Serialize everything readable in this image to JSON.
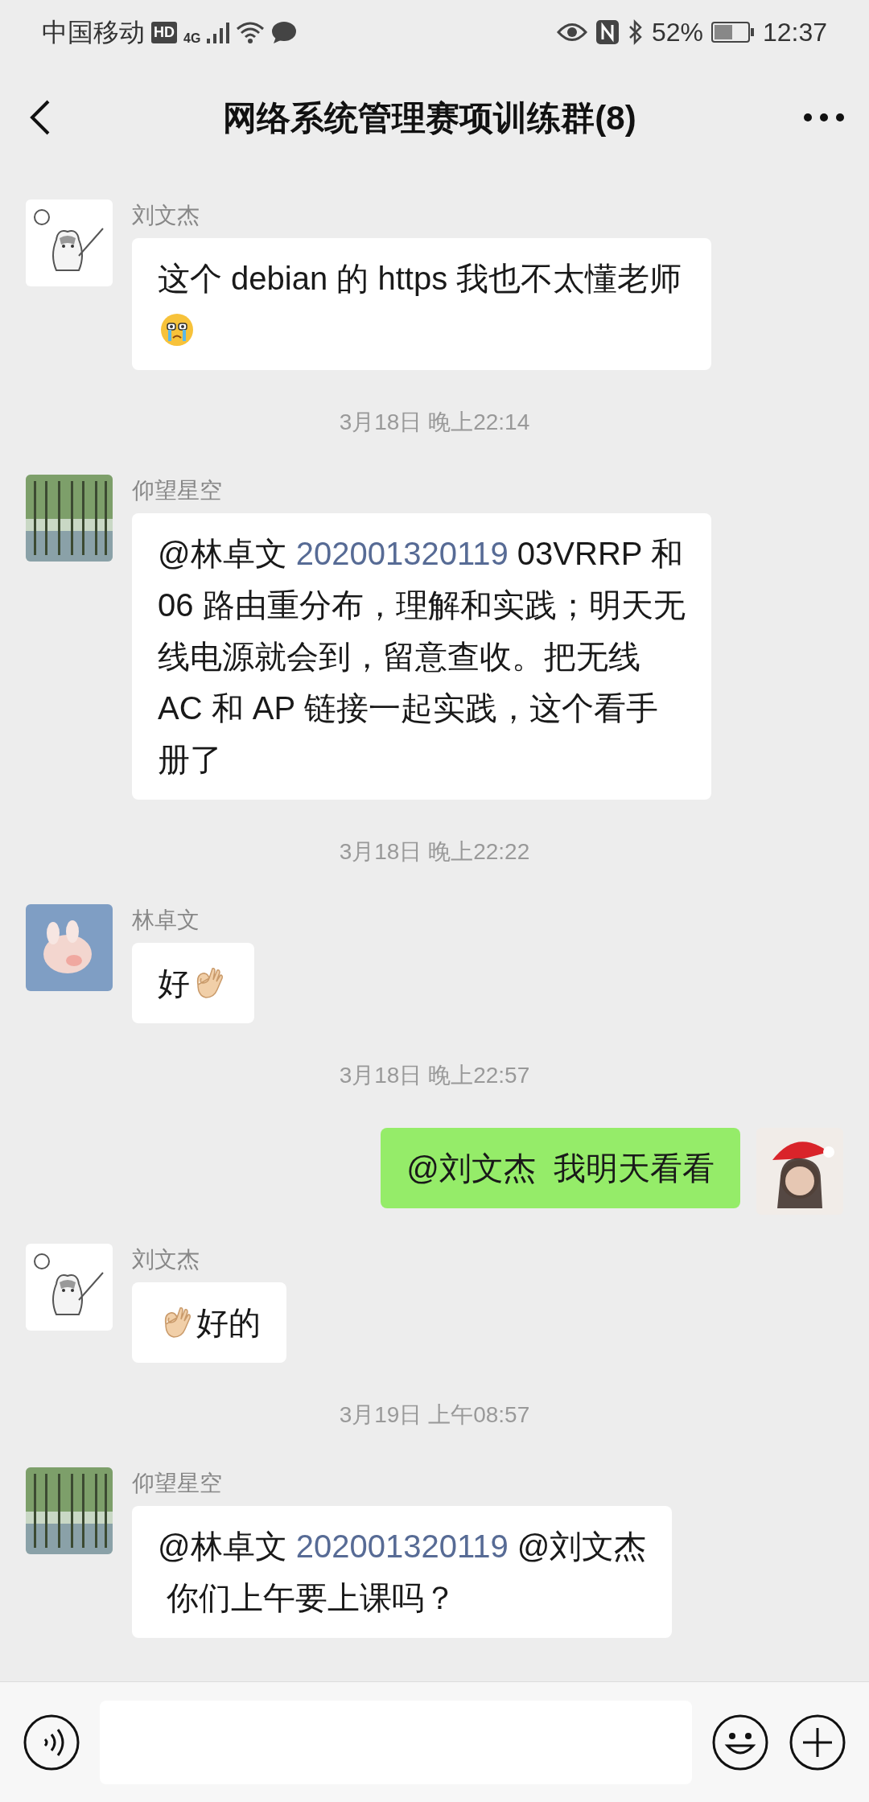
{
  "status_bar": {
    "carrier": "中国移动",
    "hd": "HD",
    "network": "4G",
    "battery": "52%",
    "time": "12:37"
  },
  "header": {
    "title": "网络系统管理赛项训练群(8)"
  },
  "messages": [
    {
      "kind": "incoming",
      "avatar": {
        "kind": "cat"
      },
      "sender": "刘文杰",
      "parts": [
        {
          "kind": "text",
          "text": "这个 debian 的 https 我也不太懂老师"
        },
        {
          "kind": "cry"
        }
      ]
    },
    {
      "kind": "time",
      "text": "3月18日 晚上22:14"
    },
    {
      "kind": "incoming",
      "avatar": {
        "kind": "trees"
      },
      "sender": "仰望星空",
      "parts": [
        {
          "kind": "text",
          "text": "@林卓文 "
        },
        {
          "kind": "link",
          "text": "202001320119"
        },
        {
          "kind": "text",
          "text": " 03VRRP 和 06 路由重分布，理解和实践；明天无线电源就会到，留意查收。把无线 AC 和 AP 链接一起实践，这个看手册了"
        }
      ]
    },
    {
      "kind": "time",
      "text": "3月18日 晚上22:22"
    },
    {
      "kind": "incoming",
      "avatar": {
        "kind": "pig"
      },
      "sender": "林卓文",
      "parts": [
        {
          "kind": "text",
          "text": "好"
        },
        {
          "kind": "ok"
        }
      ]
    },
    {
      "kind": "time",
      "text": "3月18日 晚上22:57"
    },
    {
      "kind": "outgoing",
      "avatar": {
        "kind": "person"
      },
      "parts": [
        {
          "kind": "text",
          "text": "@刘文杰  我明天看看"
        }
      ]
    },
    {
      "kind": "incoming",
      "avatar": {
        "kind": "cat"
      },
      "sender": "刘文杰",
      "parts": [
        {
          "kind": "ok"
        },
        {
          "kind": "text",
          "text": "好的"
        }
      ]
    },
    {
      "kind": "time",
      "text": "3月19日 上午08:57"
    },
    {
      "kind": "incoming",
      "avatar": {
        "kind": "trees"
      },
      "sender": "仰望星空",
      "parts": [
        {
          "kind": "text",
          "text": "@林卓文 "
        },
        {
          "kind": "link",
          "text": "202001320119"
        },
        {
          "kind": "text",
          "text": " @刘文杰"
        },
        {
          "kind": "break"
        },
        {
          "kind": "text",
          "text": " 你们上午要上课吗？"
        }
      ]
    }
  ]
}
